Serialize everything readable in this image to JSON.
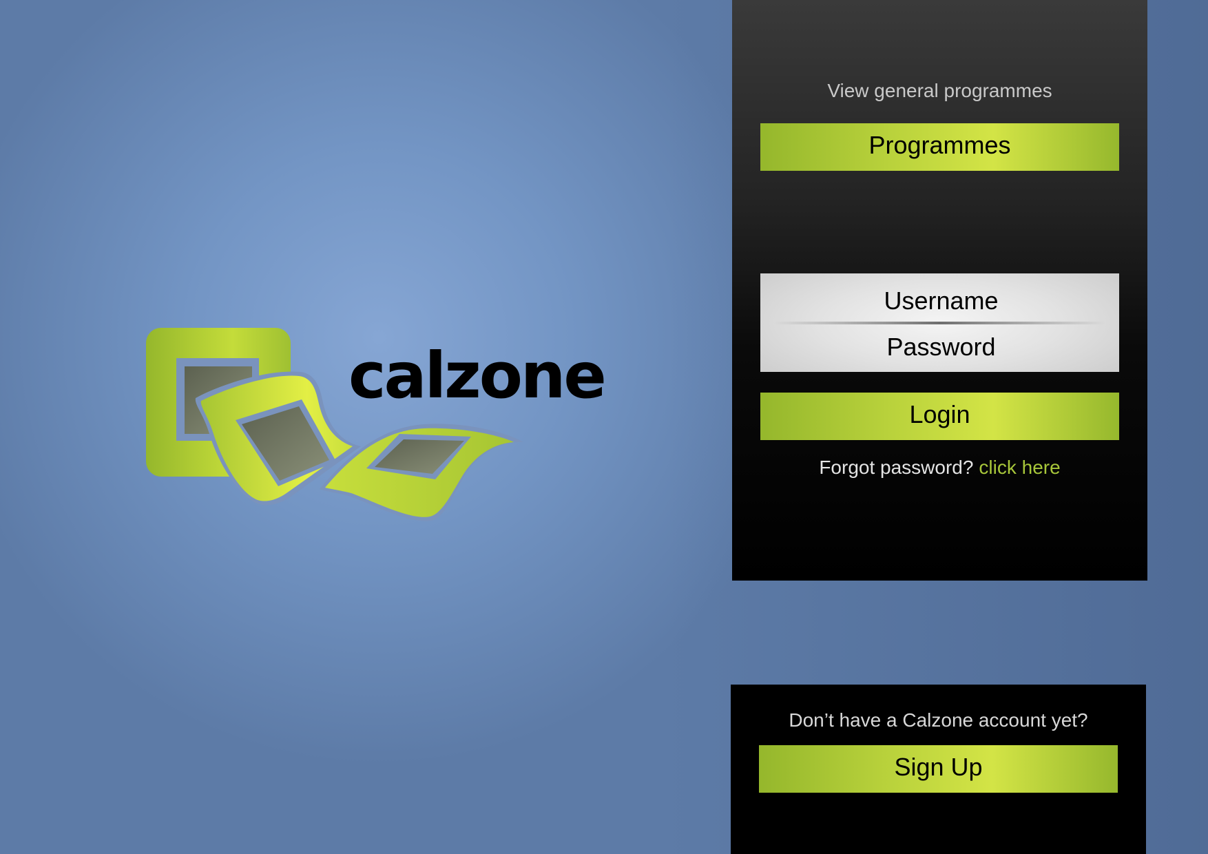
{
  "brand": {
    "name": "calzone",
    "accent_color": "#b8d13b",
    "icon": "calzone-logo-icon"
  },
  "general": {
    "label": "View general programmes",
    "button_label": "Programmes"
  },
  "login": {
    "username_placeholder": "Username",
    "password_placeholder": "Password",
    "button_label": "Login",
    "forgot_text": "Forgot password?",
    "forgot_link": "click here"
  },
  "signup": {
    "prompt": "Don’t have a Calzone account yet?",
    "button_label": "Sign Up"
  }
}
